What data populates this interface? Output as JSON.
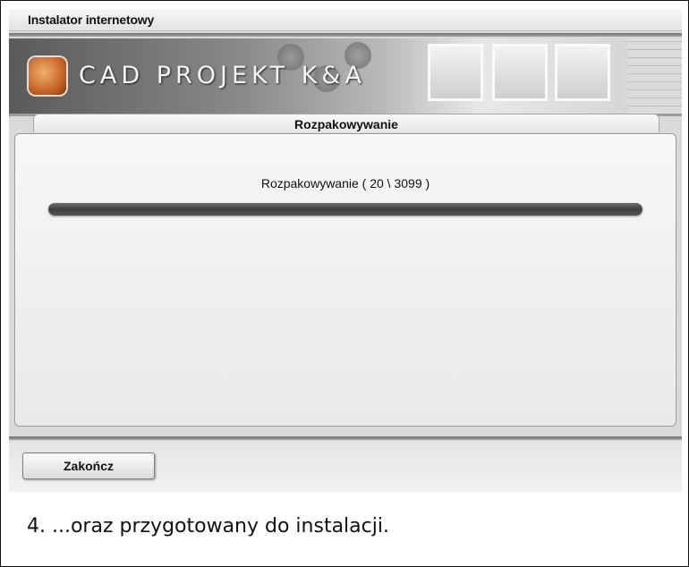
{
  "window": {
    "title": "Instalator internetowy"
  },
  "banner": {
    "logo_text": "CAD PROJEKT K&A"
  },
  "tab": {
    "label": "Rozpakowywanie"
  },
  "progress": {
    "status_text": "Rozpakowywanie ( 20 \\ 3099 )",
    "fill_fraction": 1.0
  },
  "footer": {
    "finish_button_label": "Zakończ"
  },
  "caption": "4. ...oraz przygotowany do instalacji.",
  "colors": {
    "progress_fill": "#4a4a4a",
    "logo_orange": "#c05a1a"
  },
  "icons": {
    "logo": "cad-projekt-logo-icon"
  }
}
